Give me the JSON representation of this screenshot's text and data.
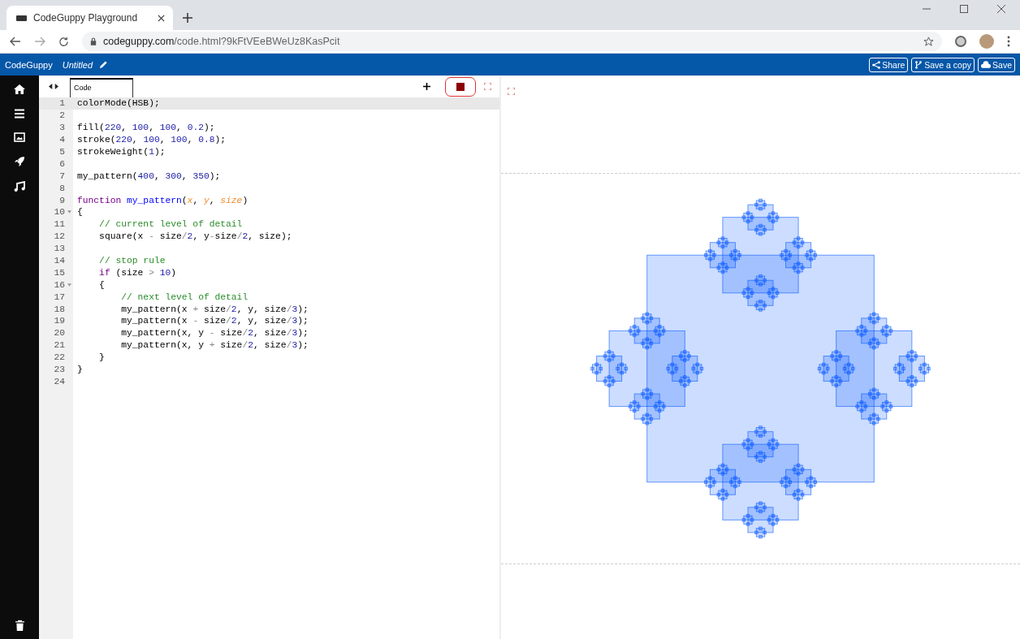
{
  "browser": {
    "tab_title": "CodeGuppy Playground",
    "url_host": "codeguppy.com",
    "url_path": "/code.html?9kFtVEeBWeUz8KasPcit"
  },
  "app_bar": {
    "brand": "CodeGuppy",
    "document_title": "Untitled",
    "buttons": [
      {
        "kind": "share",
        "label": "Share"
      },
      {
        "kind": "copy",
        "label": "Save a copy"
      },
      {
        "kind": "save",
        "label": "Save"
      }
    ]
  },
  "editor": {
    "tab": "Code",
    "lines": [
      {
        "number": "1",
        "current": true,
        "foldable": false,
        "tokens": [
          {
            "kind": "plain",
            "text": "colorMode(HSB);"
          }
        ]
      },
      {
        "number": "2",
        "current": false,
        "foldable": false
      },
      {
        "number": "3",
        "current": false,
        "foldable": false,
        "tokens": [
          {
            "kind": "plain",
            "text": "fill("
          },
          {
            "kind": "number",
            "text": "220"
          },
          {
            "kind": "plain",
            "text": ", "
          },
          {
            "kind": "number",
            "text": "100"
          },
          {
            "kind": "plain",
            "text": ", "
          },
          {
            "kind": "number",
            "text": "100"
          },
          {
            "kind": "plain",
            "text": ", "
          },
          {
            "kind": "number",
            "text": "0.2"
          },
          {
            "kind": "plain",
            "text": ");"
          }
        ]
      },
      {
        "number": "4",
        "current": false,
        "foldable": false,
        "tokens": [
          {
            "kind": "plain",
            "text": "stroke("
          },
          {
            "kind": "number",
            "text": "220"
          },
          {
            "kind": "plain",
            "text": ", "
          },
          {
            "kind": "number",
            "text": "100"
          },
          {
            "kind": "plain",
            "text": ", "
          },
          {
            "kind": "number",
            "text": "100"
          },
          {
            "kind": "plain",
            "text": ", "
          },
          {
            "kind": "number",
            "text": "0.8"
          },
          {
            "kind": "plain",
            "text": ");"
          }
        ]
      },
      {
        "number": "5",
        "current": false,
        "foldable": false,
        "tokens": [
          {
            "kind": "plain",
            "text": "strokeWeight("
          },
          {
            "kind": "number",
            "text": "1"
          },
          {
            "kind": "plain",
            "text": ");"
          }
        ]
      },
      {
        "number": "6",
        "current": false,
        "foldable": false
      },
      {
        "number": "7",
        "current": false,
        "foldable": false,
        "tokens": [
          {
            "kind": "plain",
            "text": "my_pattern("
          },
          {
            "kind": "number",
            "text": "400"
          },
          {
            "kind": "plain",
            "text": ", "
          },
          {
            "kind": "number",
            "text": "300"
          },
          {
            "kind": "plain",
            "text": ", "
          },
          {
            "kind": "number",
            "text": "350"
          },
          {
            "kind": "plain",
            "text": ");"
          }
        ]
      },
      {
        "number": "8",
        "current": false,
        "foldable": false
      },
      {
        "number": "9",
        "current": false,
        "foldable": false,
        "tokens": [
          {
            "kind": "keyword",
            "text": "function"
          },
          {
            "kind": "definition",
            "text": " my_pattern"
          },
          {
            "kind": "plain",
            "text": "("
          },
          {
            "kind": "parameter",
            "text": "x"
          },
          {
            "kind": "plain",
            "text": ", "
          },
          {
            "kind": "parameter",
            "text": "y"
          },
          {
            "kind": "plain",
            "text": ", "
          },
          {
            "kind": "parameter",
            "text": "size"
          },
          {
            "kind": "plain",
            "text": ")"
          }
        ]
      },
      {
        "number": "10",
        "current": false,
        "foldable": true,
        "tokens": [
          {
            "kind": "plain",
            "text": "{"
          }
        ]
      },
      {
        "number": "11",
        "current": false,
        "foldable": false,
        "tokens": [
          {
            "kind": "comment",
            "text": "    // current level of detail"
          }
        ]
      },
      {
        "number": "12",
        "current": false,
        "foldable": false,
        "tokens": [
          {
            "kind": "plain",
            "text": "    square(x "
          },
          {
            "kind": "operator",
            "text": "-"
          },
          {
            "kind": "plain",
            "text": " size"
          },
          {
            "kind": "operator",
            "text": "/"
          },
          {
            "kind": "number",
            "text": "2"
          },
          {
            "kind": "plain",
            "text": ", y"
          },
          {
            "kind": "operator",
            "text": "-"
          },
          {
            "kind": "plain",
            "text": "size"
          },
          {
            "kind": "operator",
            "text": "/"
          },
          {
            "kind": "number",
            "text": "2"
          },
          {
            "kind": "plain",
            "text": ", size);"
          }
        ]
      },
      {
        "number": "13",
        "current": false,
        "foldable": false
      },
      {
        "number": "14",
        "current": false,
        "foldable": false,
        "tokens": [
          {
            "kind": "comment",
            "text": "    // stop rule"
          }
        ]
      },
      {
        "number": "15",
        "current": false,
        "foldable": false,
        "tokens": [
          {
            "kind": "keyword",
            "text": "    if"
          },
          {
            "kind": "plain",
            "text": " (size "
          },
          {
            "kind": "operator",
            "text": ">"
          },
          {
            "kind": "number",
            "text": " 10"
          },
          {
            "kind": "plain",
            "text": ")"
          }
        ]
      },
      {
        "number": "16",
        "current": false,
        "foldable": true,
        "tokens": [
          {
            "kind": "plain",
            "text": "    {"
          }
        ]
      },
      {
        "number": "17",
        "current": false,
        "foldable": false,
        "tokens": [
          {
            "kind": "comment",
            "text": "        // next level of detail"
          }
        ]
      },
      {
        "number": "18",
        "current": false,
        "foldable": false,
        "tokens": [
          {
            "kind": "plain",
            "text": "        my_pattern(x "
          },
          {
            "kind": "operator",
            "text": "+"
          },
          {
            "kind": "plain",
            "text": " size"
          },
          {
            "kind": "operator",
            "text": "/"
          },
          {
            "kind": "number",
            "text": "2"
          },
          {
            "kind": "plain",
            "text": ", y, size"
          },
          {
            "kind": "operator",
            "text": "/"
          },
          {
            "kind": "number",
            "text": "3"
          },
          {
            "kind": "plain",
            "text": ");"
          }
        ]
      },
      {
        "number": "19",
        "current": false,
        "foldable": false,
        "tokens": [
          {
            "kind": "plain",
            "text": "        my_pattern(x "
          },
          {
            "kind": "operator",
            "text": "-"
          },
          {
            "kind": "plain",
            "text": " size"
          },
          {
            "kind": "operator",
            "text": "/"
          },
          {
            "kind": "number",
            "text": "2"
          },
          {
            "kind": "plain",
            "text": ", y, size"
          },
          {
            "kind": "operator",
            "text": "/"
          },
          {
            "kind": "number",
            "text": "3"
          },
          {
            "kind": "plain",
            "text": ");"
          }
        ]
      },
      {
        "number": "20",
        "current": false,
        "foldable": false,
        "tokens": [
          {
            "kind": "plain",
            "text": "        my_pattern(x, y "
          },
          {
            "kind": "operator",
            "text": "-"
          },
          {
            "kind": "plain",
            "text": " size"
          },
          {
            "kind": "operator",
            "text": "/"
          },
          {
            "kind": "number",
            "text": "2"
          },
          {
            "kind": "plain",
            "text": ", size"
          },
          {
            "kind": "operator",
            "text": "/"
          },
          {
            "kind": "number",
            "text": "3"
          },
          {
            "kind": "plain",
            "text": ");"
          }
        ]
      },
      {
        "number": "21",
        "current": false,
        "foldable": false,
        "tokens": [
          {
            "kind": "plain",
            "text": "        my_pattern(x, y "
          },
          {
            "kind": "operator",
            "text": "+"
          },
          {
            "kind": "plain",
            "text": " size"
          },
          {
            "kind": "operator",
            "text": "/"
          },
          {
            "kind": "number",
            "text": "2"
          },
          {
            "kind": "plain",
            "text": ", size"
          },
          {
            "kind": "operator",
            "text": "/"
          },
          {
            "kind": "number",
            "text": "3"
          },
          {
            "kind": "plain",
            "text": ");"
          }
        ]
      },
      {
        "number": "22",
        "current": false,
        "foldable": false,
        "tokens": [
          {
            "kind": "plain",
            "text": "    }"
          }
        ]
      },
      {
        "number": "23",
        "current": false,
        "foldable": false,
        "tokens": [
          {
            "kind": "plain",
            "text": "}"
          }
        ]
      },
      {
        "number": "24",
        "current": false,
        "foldable": false
      }
    ]
  }
}
